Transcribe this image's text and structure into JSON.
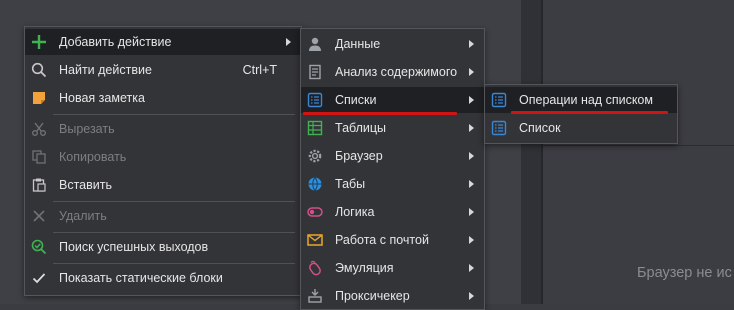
{
  "background": {
    "placeholder": "Браузер не ис"
  },
  "context_menu": {
    "items": [
      {
        "label": "Добавить действие",
        "icon": "plus-icon",
        "submenu": true
      },
      {
        "label": "Найти действие",
        "icon": "search-icon",
        "shortcut": "Ctrl+T"
      },
      {
        "label": "Новая заметка",
        "icon": "sticky-note-icon"
      },
      {
        "label": "Вырезать",
        "icon": "scissors-icon",
        "disabled": true
      },
      {
        "label": "Копировать",
        "icon": "copy-icon",
        "disabled": true
      },
      {
        "label": "Вставить",
        "icon": "paste-icon"
      },
      {
        "label": "Удалить",
        "icon": "close-icon",
        "disabled": true
      },
      {
        "label": "Поиск успешных выходов",
        "icon": "search-success-icon"
      },
      {
        "label": "Показать статические блоки",
        "icon": "checkmark-icon"
      }
    ]
  },
  "add_action_menu": {
    "items": [
      {
        "label": "Данные",
        "icon": "user-icon"
      },
      {
        "label": "Анализ содержимого",
        "icon": "document-icon"
      },
      {
        "label": "Списки",
        "icon": "list-icon",
        "highlighted": true
      },
      {
        "label": "Таблицы",
        "icon": "table-icon"
      },
      {
        "label": "Браузер",
        "icon": "gear-icon"
      },
      {
        "label": "Табы",
        "icon": "globe-icon"
      },
      {
        "label": "Логика",
        "icon": "toggle-icon"
      },
      {
        "label": "Работа с почтой",
        "icon": "mail-icon"
      },
      {
        "label": "Эмуляция",
        "icon": "mouse-icon"
      },
      {
        "label": "Проксичекер",
        "icon": "proxy-icon"
      }
    ]
  },
  "lists_menu": {
    "items": [
      {
        "label": "Операции над списком",
        "icon": "list-icon",
        "highlighted": true
      },
      {
        "label": "Список",
        "icon": "list-icon"
      }
    ]
  },
  "colors": {
    "accent_red": "#d01414",
    "highlight": "#1f2023",
    "list_icon_blue": "#3a86d6"
  }
}
